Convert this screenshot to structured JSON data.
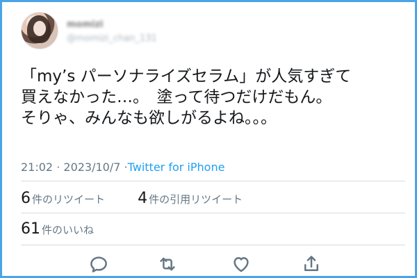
{
  "tweet": {
    "user": {
      "display_name": "momizi",
      "handle": "@momizi_chan_131"
    },
    "text_lines": [
      "「my’s パーソナライズセラム」が人気すぎて",
      "買えなかった…。　塗って待つだけだもん。",
      "そりゃ、みんなも欲しがるよね。。。"
    ],
    "time": "21:02",
    "date": "2023/10/7",
    "source": "Twitter for iPhone",
    "separator": "·"
  },
  "stats": {
    "retweets": {
      "count": "6",
      "label": "件のリツイート"
    },
    "quotes": {
      "count": "4",
      "label": "件の引用リツイート"
    },
    "likes": {
      "count": "61",
      "label": "件のいいね"
    }
  },
  "actions": {
    "icons": [
      "reply-icon",
      "retweet-icon",
      "like-icon",
      "share-icon"
    ],
    "icon_color": "#657786"
  },
  "colors": {
    "frame_border": "#4aa3e6",
    "link": "#1da1f2",
    "text": "#14171a",
    "muted": "#657786"
  }
}
